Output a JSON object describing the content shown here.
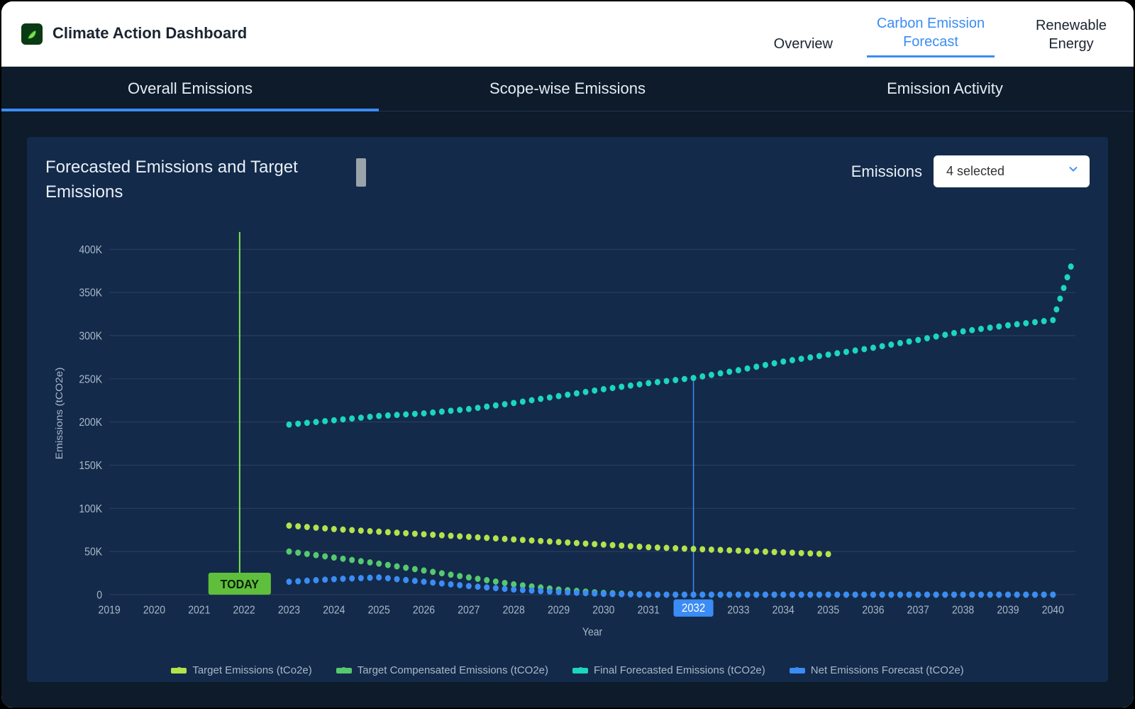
{
  "app": {
    "title": "Climate Action Dashboard"
  },
  "top_tabs": {
    "items": [
      {
        "label": "Overview",
        "active": false
      },
      {
        "label": "Carbon Emission Forecast",
        "active": true
      },
      {
        "label": "Renewable Energy",
        "active": false
      }
    ]
  },
  "sub_tabs": {
    "items": [
      {
        "label": "Overall Emissions",
        "active": true
      },
      {
        "label": "Scope-wise Emissions",
        "active": false
      },
      {
        "label": "Emission Activity",
        "active": false
      }
    ]
  },
  "chart_header": {
    "title": "Forecasted Emissions and Target Emissions",
    "selector_label": "Emissions",
    "selector_value": "4 selected"
  },
  "markers": {
    "today_label": "TODAY",
    "today_x": 2021.9,
    "ref_year_label": "2032",
    "ref_year_x": 2032
  },
  "chart_data": {
    "type": "line",
    "title": "Forecasted Emissions and Target Emissions",
    "xlabel": "Year",
    "ylabel": "Emissions (tCO2e)",
    "xlim": [
      2019,
      2040.5
    ],
    "ylim": [
      0,
      420000
    ],
    "x_ticks": [
      2019,
      2020,
      2021,
      2022,
      2023,
      2024,
      2025,
      2026,
      2027,
      2028,
      2029,
      2030,
      2031,
      2032,
      2033,
      2034,
      2035,
      2036,
      2037,
      2038,
      2039,
      2040
    ],
    "y_ticks": [
      0,
      50000,
      100000,
      150000,
      200000,
      250000,
      300000,
      350000,
      400000
    ],
    "y_tick_labels": [
      "0",
      "50K",
      "100K",
      "150K",
      "200K",
      "250K",
      "300K",
      "350K",
      "400K"
    ],
    "series": [
      {
        "name": "Target Emissions (tCo2e)",
        "color": "#b2e34b",
        "x": [
          2023,
          2024,
          2025,
          2026,
          2027,
          2028,
          2029,
          2030,
          2031,
          2032,
          2033,
          2034,
          2035
        ],
        "values": [
          80000,
          76000,
          73000,
          70000,
          67000,
          64000,
          61000,
          58000,
          55000,
          53000,
          51000,
          49000,
          47000
        ]
      },
      {
        "name": "Target Compensated Emissions (tCO2e)",
        "color": "#55c96e",
        "x": [
          2023,
          2024,
          2025,
          2026,
          2027,
          2028,
          2029,
          2030,
          2031,
          2032,
          2033,
          2034,
          2035,
          2036,
          2037,
          2038,
          2039,
          2040
        ],
        "values": [
          50000,
          43000,
          36000,
          28000,
          20000,
          12000,
          6000,
          2000,
          0,
          0,
          0,
          0,
          0,
          0,
          0,
          0,
          0,
          0
        ]
      },
      {
        "name": "Final Forecasted Emissions (tCO2e)",
        "color": "#1cd6bd",
        "x": [
          2023,
          2024,
          2025,
          2026,
          2027,
          2028,
          2029,
          2030,
          2031,
          2032,
          2033,
          2034,
          2035,
          2036,
          2037,
          2038,
          2039,
          2040,
          2040.4
        ],
        "values": [
          197000,
          202000,
          207000,
          210000,
          215000,
          222000,
          230000,
          238000,
          245000,
          251000,
          260000,
          270000,
          278000,
          286000,
          295000,
          305000,
          312000,
          318000,
          380000
        ]
      },
      {
        "name": "Net Emissions Forecast (tCO2e)",
        "color": "#3b8cf5",
        "x": [
          2023,
          2024,
          2025,
          2026,
          2027,
          2028,
          2029,
          2030,
          2031,
          2032,
          2033,
          2034,
          2035,
          2036,
          2037,
          2038,
          2039,
          2040
        ],
        "values": [
          15000,
          18000,
          20000,
          15000,
          10000,
          6000,
          3000,
          1000,
          0,
          0,
          0,
          0,
          0,
          0,
          0,
          0,
          0,
          0
        ]
      }
    ],
    "legend_position": "bottom"
  }
}
